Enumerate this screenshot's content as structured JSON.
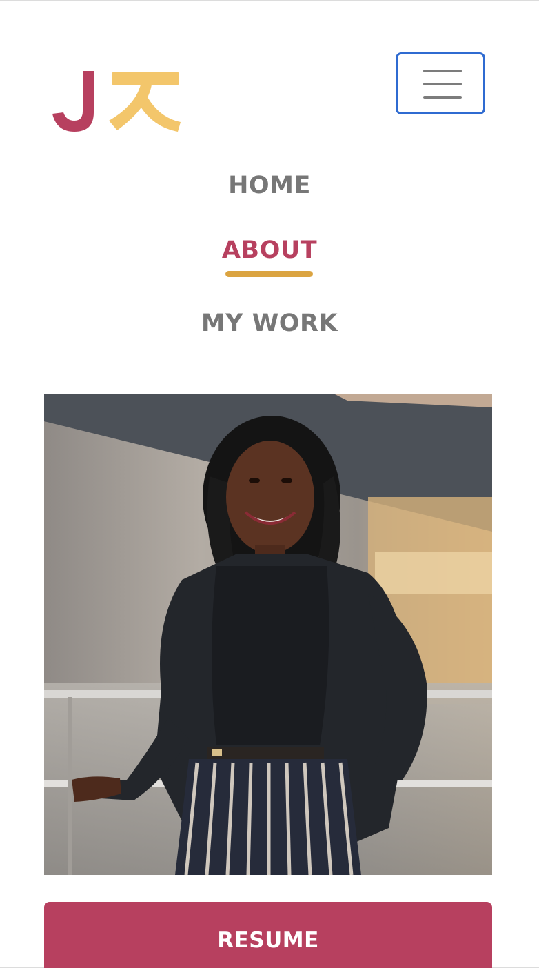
{
  "brand": {
    "logo_icon": "jx-monogram-logo",
    "logo_text": "Jㅈ",
    "primary_color": "#b7405f",
    "secondary_color": "#f3c66b"
  },
  "header": {
    "menu_icon": "hamburger-menu-icon",
    "menu_toggle_border_color": "#2f6bd1"
  },
  "nav": {
    "items": [
      {
        "label": "HOME",
        "active": false
      },
      {
        "label": "ABOUT",
        "active": true
      },
      {
        "label": "MY WORK",
        "active": false
      }
    ],
    "active_underline_color": "#dba441"
  },
  "main": {
    "photo_description_icon": "portrait-photo",
    "resume_label": "RESUME"
  }
}
